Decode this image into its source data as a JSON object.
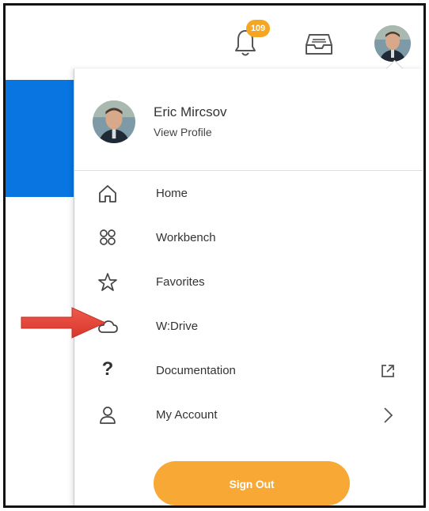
{
  "header": {
    "notifications_count": "109",
    "notification_icon": "bell-icon",
    "inbox_icon": "inbox-icon",
    "avatar_icon": "avatar"
  },
  "profile": {
    "name": "Eric Mircsov",
    "link": "View Profile"
  },
  "menu": {
    "items": [
      {
        "label": "Home",
        "icon": "home-icon"
      },
      {
        "label": "Workbench",
        "icon": "people-icon"
      },
      {
        "label": "Favorites",
        "icon": "star-icon"
      },
      {
        "label": "W:Drive",
        "icon": "cloud-icon"
      },
      {
        "label": "Documentation",
        "icon": "question-icon",
        "trailing_icon": "external-link-icon"
      },
      {
        "label": "My Account",
        "icon": "user-icon",
        "trailing_icon": "chevron-right-icon"
      }
    ],
    "sign_out": "Sign Out"
  },
  "colors": {
    "accent_orange": "#f7a835",
    "blue": "#0875e1",
    "arrow_red": "#e53b30"
  }
}
